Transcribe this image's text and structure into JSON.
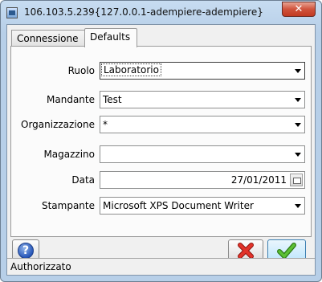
{
  "window": {
    "title": "106.103.5.239{127.0.0.1-adempiere-adempiere}",
    "close_label": "✕"
  },
  "tabs": [
    {
      "label": "Connessione",
      "active": false
    },
    {
      "label": "Defaults",
      "active": true
    }
  ],
  "form": {
    "ruolo": {
      "label": "Ruolo",
      "value": "Laboratorio"
    },
    "mandante": {
      "label": "Mandante",
      "value": "Test"
    },
    "organizzazione": {
      "label": "Organizzazione",
      "value": "*"
    },
    "magazzino": {
      "label": "Magazzino",
      "value": ""
    },
    "data": {
      "label": "Data",
      "value": "27/01/2011"
    },
    "stampante": {
      "label": "Stampante",
      "value": "Microsoft XPS Document Writer"
    }
  },
  "buttons": {
    "help_glyph": "?",
    "cancel_icon": "red-x-icon",
    "ok_icon": "green-check-icon"
  },
  "status": {
    "text": "Authorizzato"
  },
  "colors": {
    "cancel": "#d9261c",
    "ok": "#4aa02c"
  }
}
